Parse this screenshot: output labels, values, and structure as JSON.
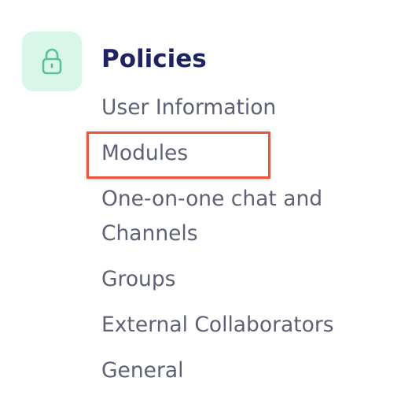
{
  "policies": {
    "icon": "lock-icon",
    "icon_color": "#58c39b",
    "tile_color": "#d9f7e9",
    "title": "Policies",
    "items": [
      {
        "label": "User Information"
      },
      {
        "label": "Modules",
        "highlighted": true
      },
      {
        "label": "One-on-one chat and Channels"
      },
      {
        "label": "Groups"
      },
      {
        "label": "External Collaborators"
      },
      {
        "label": "General"
      }
    ]
  },
  "colors": {
    "title": "#1f2461",
    "item_text": "#5e6176",
    "highlight_border": "#e8573a"
  }
}
